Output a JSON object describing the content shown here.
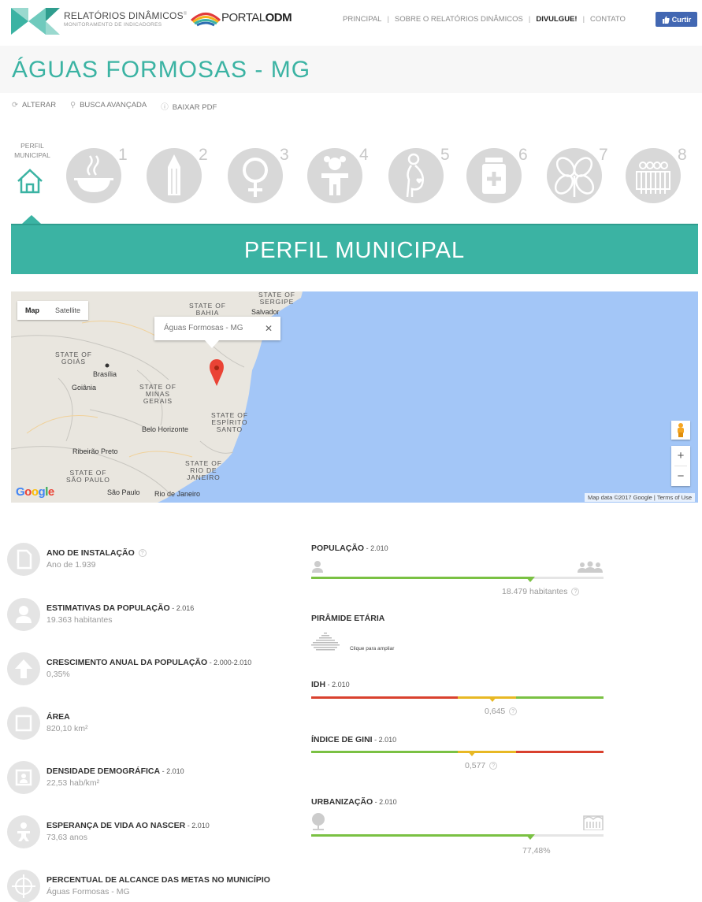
{
  "header": {
    "brand_title": "RELATÓRIOS DINÂMICOS",
    "brand_trademark": "®",
    "brand_subtitle": "MONITORAMENTO DE INDICADORES",
    "portal_prefix": "PORTAL",
    "portal_suffix": "ODM",
    "nav": [
      "PRINCIPAL",
      "SOBRE O RELATÓRIOS DINÂMICOS",
      "DIVULGUE!",
      "CONTATO"
    ],
    "nav_separator": "|",
    "fb_label": "Curtir",
    "colors": {
      "accent": "#3bb3a3",
      "fb": "#4267b2"
    }
  },
  "page": {
    "city_title": "ÁGUAS FORMOSAS - MG",
    "tools": [
      {
        "icon": "refresh-icon",
        "label": "ALTERAR"
      },
      {
        "icon": "search-icon",
        "label": "BUSCA AVANÇADA"
      },
      {
        "icon": "download-icon",
        "label": "BAIXAR PDF"
      }
    ]
  },
  "goals": {
    "profile_label_1": "PERFIL",
    "profile_label_2": "MUNICIPAL",
    "items": [
      {
        "num": "1",
        "icon": "bowl-icon"
      },
      {
        "num": "2",
        "icon": "pencil-icon"
      },
      {
        "num": "3",
        "icon": "female-icon"
      },
      {
        "num": "4",
        "icon": "child-icon"
      },
      {
        "num": "5",
        "icon": "pregnant-icon"
      },
      {
        "num": "6",
        "icon": "medicine-icon"
      },
      {
        "num": "7",
        "icon": "leaf-icon"
      },
      {
        "num": "8",
        "icon": "people-icon"
      }
    ]
  },
  "section": {
    "title": "PERFIL MUNICIPAL"
  },
  "map": {
    "type_map": "Map",
    "type_satellite": "Satellite",
    "info_window": "Águas Formosas - MG",
    "close": "✕",
    "labels": {
      "sergipe_1": "STATE OF",
      "sergipe_2": "SERGIPE",
      "bahia_1": "STATE OF",
      "bahia_2": "BAHIA",
      "salvador": "Salvador",
      "goias_1": "STATE OF",
      "goias_2": "GOIÁS",
      "brasilia": "Brasília",
      "goiania": "Goiânia",
      "minas_1": "STATE OF",
      "minas_2": "MINAS",
      "minas_3": "GERAIS",
      "espirito_1": "STATE OF",
      "espirito_2": "ESPÍRITO",
      "espirito_3": "SANTO",
      "belo_horizonte": "Belo Horizonte",
      "ribeirao_preto": "Ribeirão Preto",
      "rio_1": "STATE OF",
      "rio_2": "RIO DE",
      "rio_3": "JANEIRO",
      "sp_1": "STATE OF",
      "sp_2": "SÃO PAULO",
      "sao_paulo": "São Paulo",
      "rio_de_janeiro": "Rio de Janeiro"
    },
    "google": "Google",
    "attribution": "Map data ©2017 Google  |  Terms of Use",
    "zoom_in": "+",
    "zoom_out": "−"
  },
  "info": [
    {
      "icon": "document-icon",
      "label": "ANO DE INSTALAÇÃO",
      "year": "",
      "help": "?",
      "value": "Ano de 1.939"
    },
    {
      "icon": "person-icon",
      "label": "ESTIMATIVAS DA POPULAÇÃO",
      "year": " - 2.016",
      "value": "19.363 habitantes"
    },
    {
      "icon": "arrow-up-icon",
      "label": "CRESCIMENTO ANUAL DA POPULAÇÃO",
      "year": " - 2.000-2.010",
      "value": "0,35%"
    },
    {
      "icon": "square-icon",
      "label": "ÁREA",
      "year": "",
      "value": "820,10 km²"
    },
    {
      "icon": "portrait-icon",
      "label": "DENSIDADE DEMOGRÁFICA",
      "year": " - 2.010",
      "value": "22,53 hab/km²"
    },
    {
      "icon": "baby-icon",
      "label": "ESPERANÇA DE VIDA AO NASCER",
      "year": " - 2.010",
      "value": "73,63 anos"
    },
    {
      "icon": "target-icon",
      "label": "PERCENTUAL DE ALCANCE DAS METAS NO MUNICÍPIO",
      "year": "",
      "value": "Águas Formosas - MG"
    }
  ],
  "indicators": {
    "populacao": {
      "label": "POPULAÇÃO",
      "year": " - 2.010",
      "value": "18.479 habitantes",
      "help": "?",
      "position_pct": 75
    },
    "piramide": {
      "label": "PIRÂMIDE ETÁRIA",
      "link": "Clique para ampliar"
    },
    "idh": {
      "label": "IDH",
      "year": " - 2.010",
      "value": "0,645",
      "help": "?",
      "position_pct": 62
    },
    "gini": {
      "label": "ÍNDICE DE GINI",
      "year": " - 2.010",
      "value": "0,577",
      "help": "?",
      "position_pct": 55
    },
    "urbanizacao": {
      "label": "URBANIZAÇÃO",
      "year": " - 2.010",
      "value": "77,48%",
      "position_pct": 75
    },
    "colors": {
      "green": "#7ac143",
      "yellow": "#e8b824",
      "red": "#d9412e",
      "track": "#e5e5e5"
    }
  }
}
